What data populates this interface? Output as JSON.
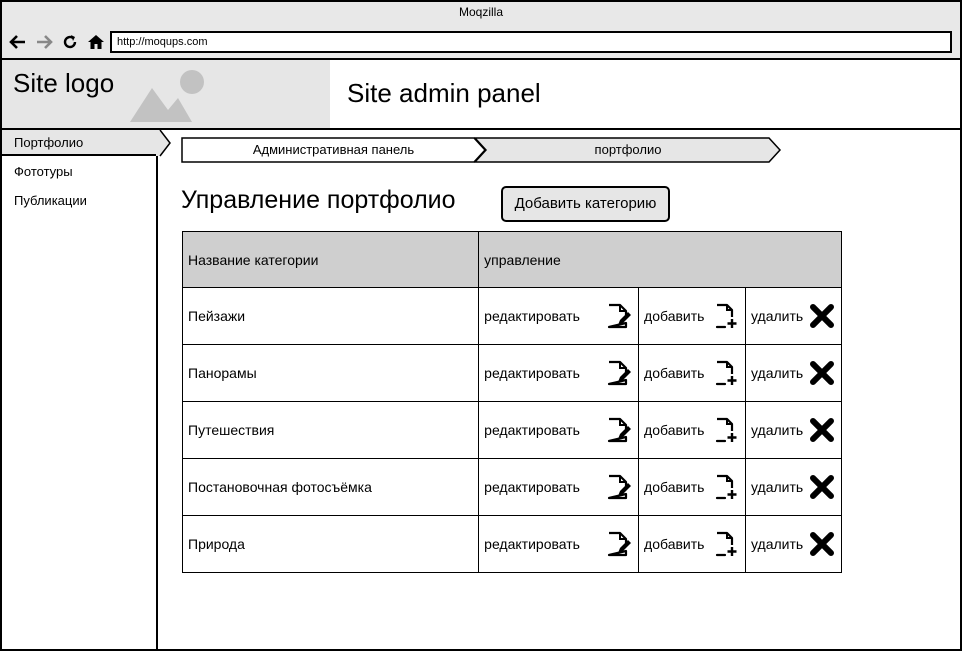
{
  "window": {
    "title": "Moqzilla"
  },
  "browser": {
    "url": "http://moqups.com"
  },
  "header": {
    "logo_text": "Site logo",
    "title": "Site admin panel"
  },
  "sidebar": {
    "items": [
      {
        "label": "Портфолио",
        "active": true
      },
      {
        "label": "Фототуры",
        "active": false
      },
      {
        "label": "Публикации",
        "active": false
      }
    ]
  },
  "breadcrumb": {
    "items": [
      "Административная панель",
      "портфолио"
    ]
  },
  "main": {
    "heading": "Управление портфолио",
    "add_category_label": "Добавить категорию"
  },
  "table": {
    "headers": [
      "Название категории",
      "управление"
    ],
    "actions": {
      "edit": "редактировать",
      "add": "добавить",
      "delete": "удалить"
    },
    "rows": [
      "Пейзажи",
      "Панорамы",
      "Путешествия",
      "Постановочная фотосъёмка",
      "Природа"
    ]
  },
  "colors": {
    "panel_gray": "#e6e6e6",
    "header_gray": "#cfcfcf"
  }
}
